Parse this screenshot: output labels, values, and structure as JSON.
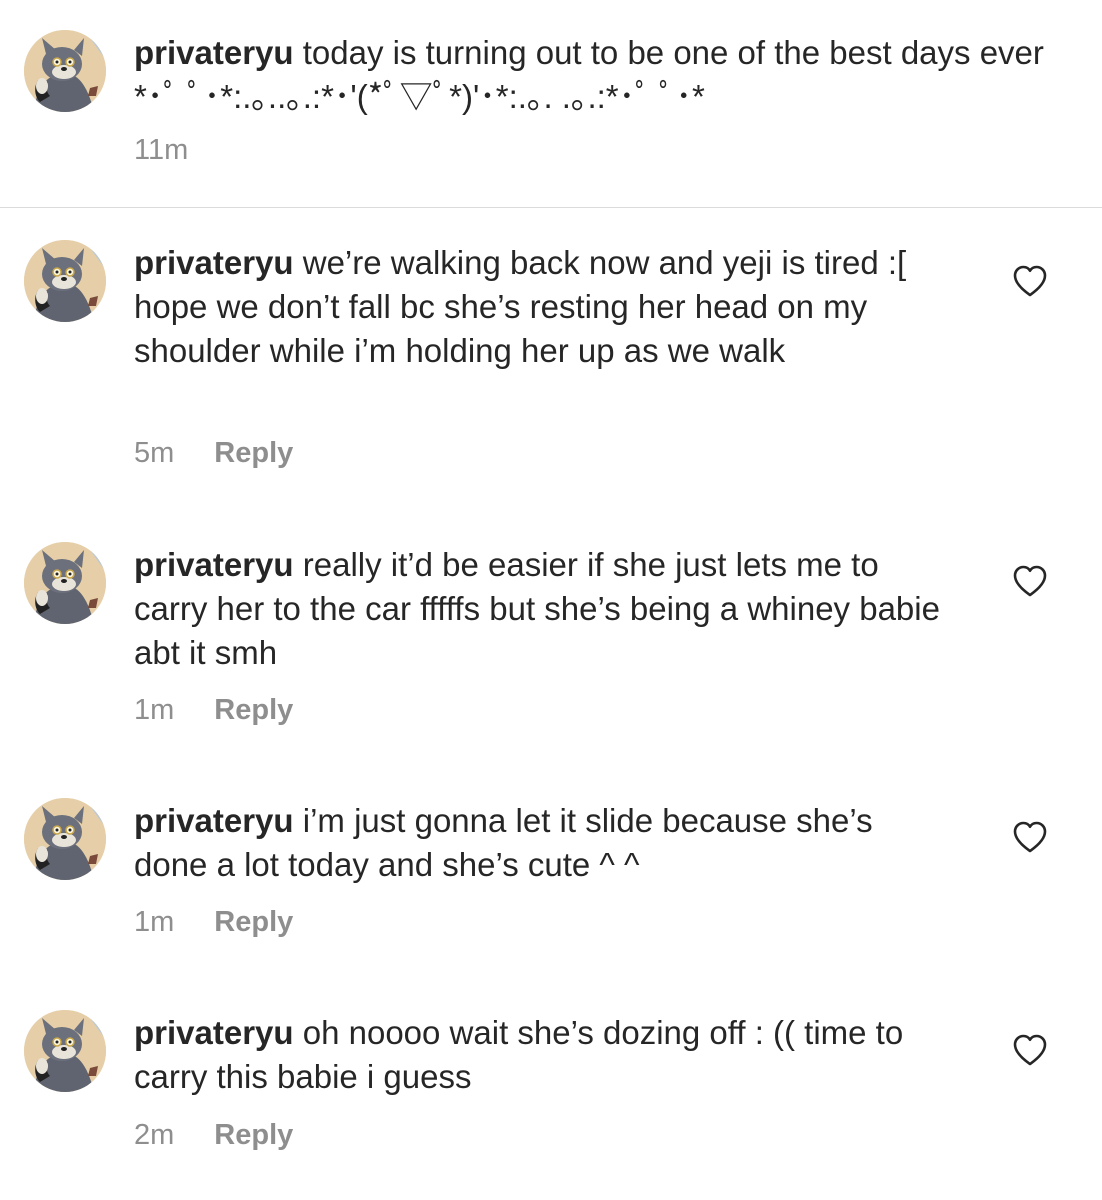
{
  "comments": [
    {
      "username": "privateryu",
      "text": " today is turning out to be one of the best days ever *･ﾟ ﾟ･*:.｡..｡.:*･'(*ﾟ▽ﾟ*)'･*:.｡. .｡.:*･ﾟ ﾟ･*",
      "time": "11m",
      "reply_label": ""
    },
    {
      "username": "privateryu",
      "text": " we’re walking back now and yeji is tired :[ hope we don’t fall bc she’s resting her head on my shoulder while i’m holding her up as we walk",
      "time": "5m",
      "reply_label": "Reply"
    },
    {
      "username": "privateryu",
      "text": " really it’d be easier if she just lets me to carry her to the car fffffs but she’s being a whiney babie abt it smh",
      "time": "1m",
      "reply_label": "Reply"
    },
    {
      "username": "privateryu",
      "text": " i’m just gonna let it slide because she’s done a lot today and she’s cute ^ ^",
      "time": "1m",
      "reply_label": "Reply"
    },
    {
      "username": "privateryu",
      "text": " oh noooo wait she’s dozing off : (( time to carry this babie i guess",
      "time": "2m",
      "reply_label": "Reply"
    }
  ],
  "icons": {
    "like": "heart-outline-icon",
    "avatar": "cartoon-cat-avatar"
  },
  "colors": {
    "text": "#262626",
    "meta": "#8e8e8e",
    "divider": "#dbdbdb"
  }
}
